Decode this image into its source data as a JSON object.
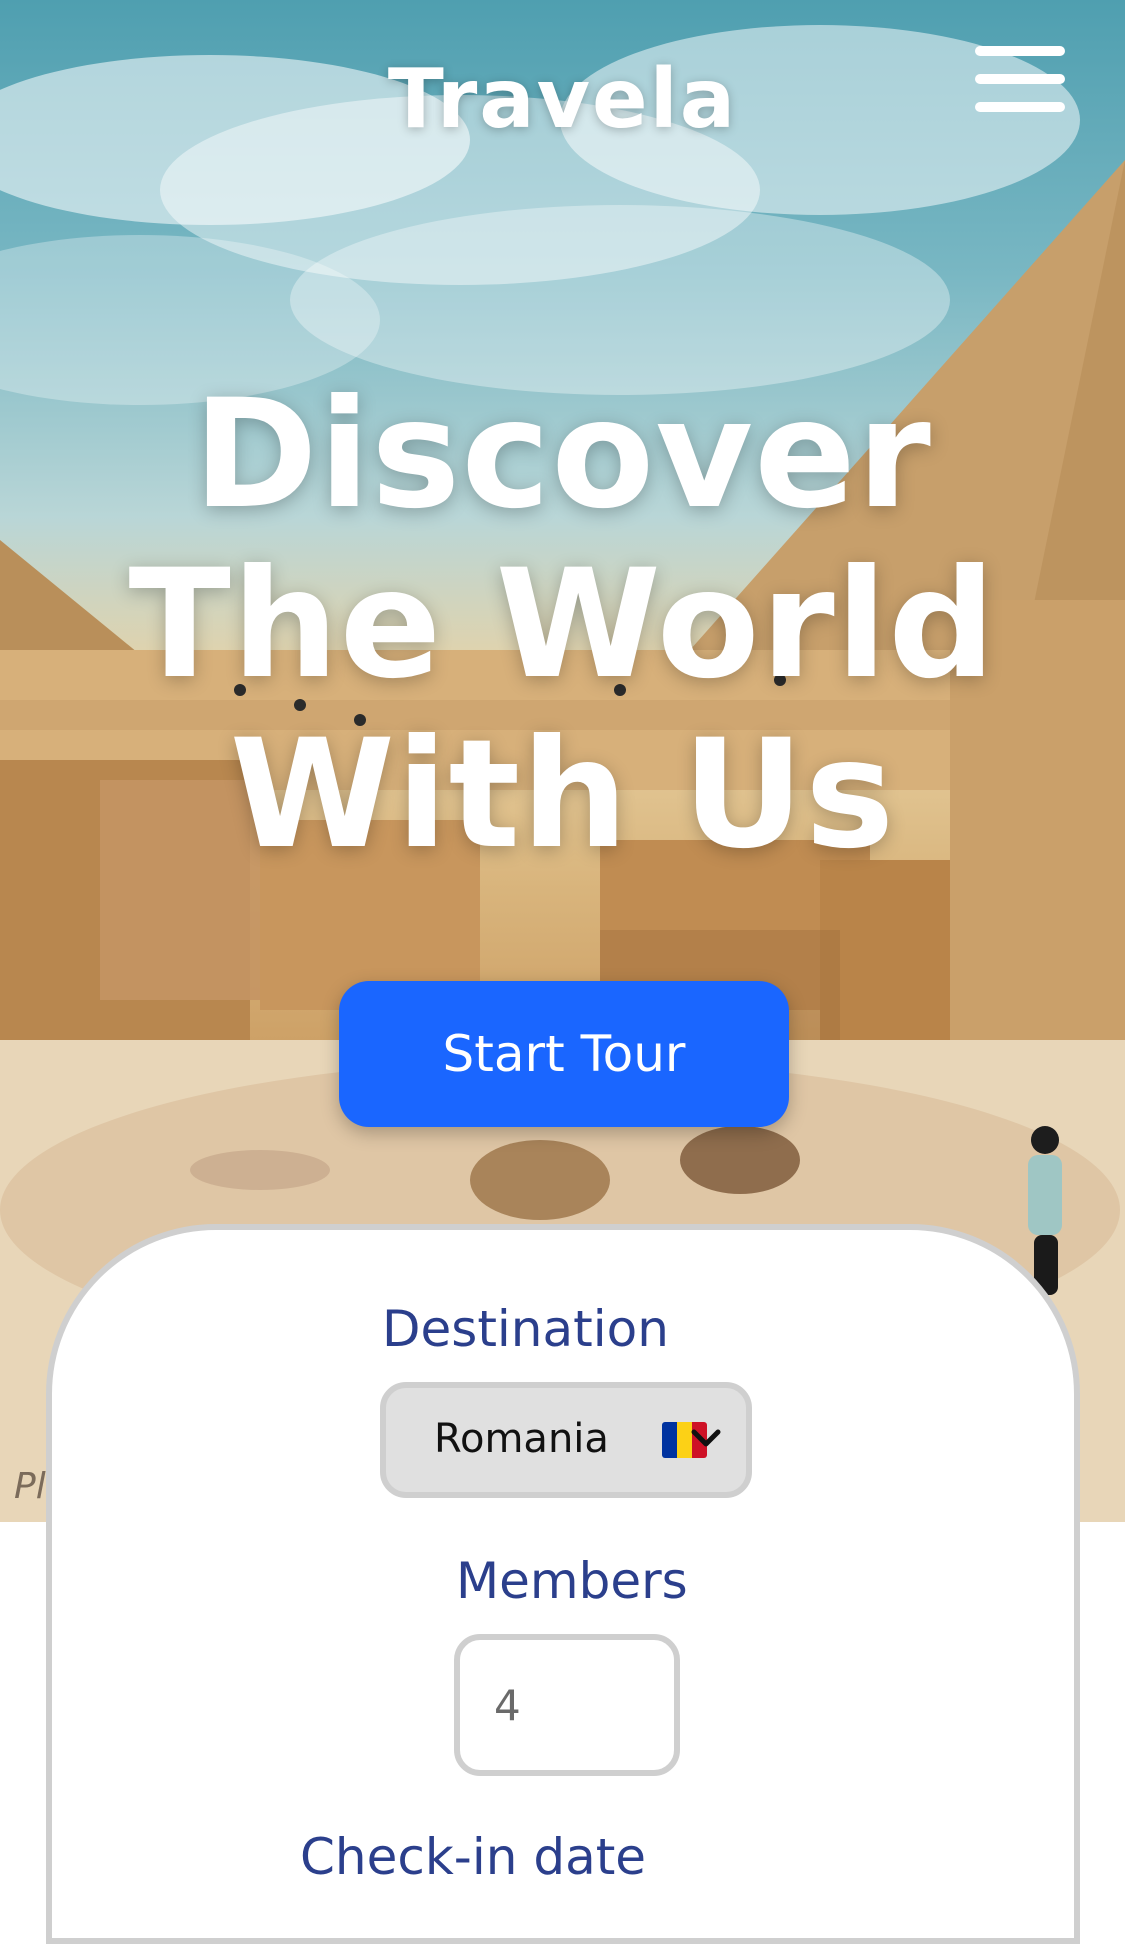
{
  "header": {
    "brand": "Travela"
  },
  "hero": {
    "headline_lines": [
      "Discover",
      "The World",
      "With Us"
    ],
    "cta_label": "Start Tour",
    "credit_text": "Pl"
  },
  "booking": {
    "destination_label": "Destination",
    "destination_value": "Romania",
    "members_label": "Members",
    "members_value": "4",
    "checkin_label": "Check-in date"
  },
  "icons": {
    "menu": "hamburger-menu-icon",
    "flag": "romania-flag-icon",
    "chevron": "chevron-down-icon"
  },
  "colors": {
    "primary": "#1a66ff",
    "label_blue": "#2b3f8c",
    "border_gray": "#cfcfcf",
    "select_bg": "#e0e0e0"
  }
}
